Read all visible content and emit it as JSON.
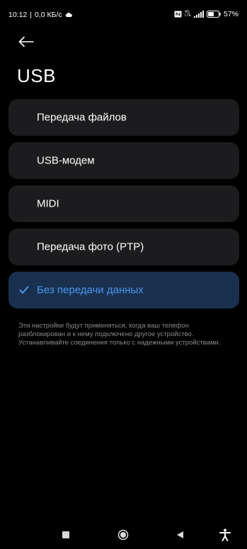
{
  "status_bar": {
    "time": "10:12",
    "separator": "|",
    "speed": "0,0 КБ/с",
    "network_type": "4G",
    "network_sub": "LTE",
    "battery_percent": "57%",
    "battery_level": 0.57
  },
  "header": {
    "back_icon": "arrow-left-icon",
    "title": "USB"
  },
  "options": [
    {
      "label": "Передача файлов",
      "selected": false
    },
    {
      "label": "USB-модем",
      "selected": false
    },
    {
      "label": "MIDI",
      "selected": false
    },
    {
      "label": "Передача фото (PTP)",
      "selected": false
    },
    {
      "label": "Без передачи данных",
      "selected": true
    }
  ],
  "note": "Эти настройки будут применяться, когда ваш телефон разблокирован и к нему подключено другое устройство. Устанавливайте соединения только с надежными устройствами.",
  "nav_bar": {
    "recents_icon": "square-icon",
    "home_icon": "circle-icon",
    "back_icon": "triangle-back-icon",
    "accessibility_icon": "accessibility-icon"
  },
  "colors": {
    "background": "#000000",
    "card": "#1c1c1e",
    "selected_card": "#19314f",
    "accent": "#4b97ee",
    "note_text": "#8a8a8e"
  }
}
